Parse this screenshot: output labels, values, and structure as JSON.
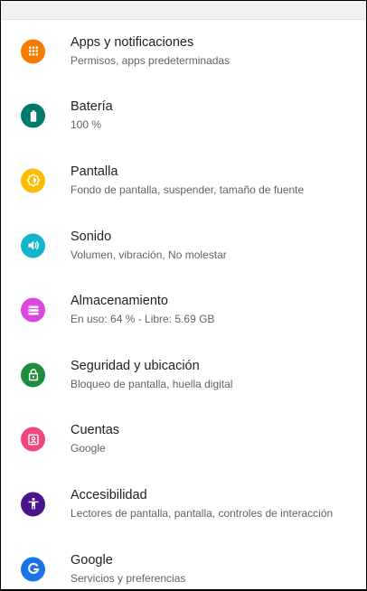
{
  "settings": {
    "items": [
      {
        "title": "Apps y notificaciones",
        "subtitle": "Permisos, apps predeterminadas",
        "icon": "apps-grid-icon",
        "color": "#f57c00"
      },
      {
        "title": "Batería",
        "subtitle": "100 %",
        "icon": "battery-icon",
        "color": "#00796b"
      },
      {
        "title": "Pantalla",
        "subtitle": "Fondo de pantalla, suspender, tamaño de fuente",
        "icon": "brightness-icon",
        "color": "#fbbc04"
      },
      {
        "title": "Sonido",
        "subtitle": "Volumen, vibración, No molestar",
        "icon": "volume-icon",
        "color": "#12b5cb"
      },
      {
        "title": "Almacenamiento",
        "subtitle": "En uso: 64 % - Libre: 5.69 GB",
        "icon": "storage-icon",
        "color": "#d948e0"
      },
      {
        "title": "Seguridad y ubicación",
        "subtitle": "Bloqueo de pantalla, huella digital",
        "icon": "lock-icon",
        "color": "#1e8e3e"
      },
      {
        "title": "Cuentas",
        "subtitle": "Google",
        "icon": "account-box-icon",
        "color": "#f0487d"
      },
      {
        "title": "Accesibilidad",
        "subtitle": "Lectores de pantalla, pantalla, controles de interacción",
        "icon": "accessibility-icon",
        "color": "#4a148c"
      },
      {
        "title": "Google",
        "subtitle": "Servicios y preferencias",
        "icon": "google-g-icon",
        "color": "#1a73e8"
      }
    ]
  }
}
